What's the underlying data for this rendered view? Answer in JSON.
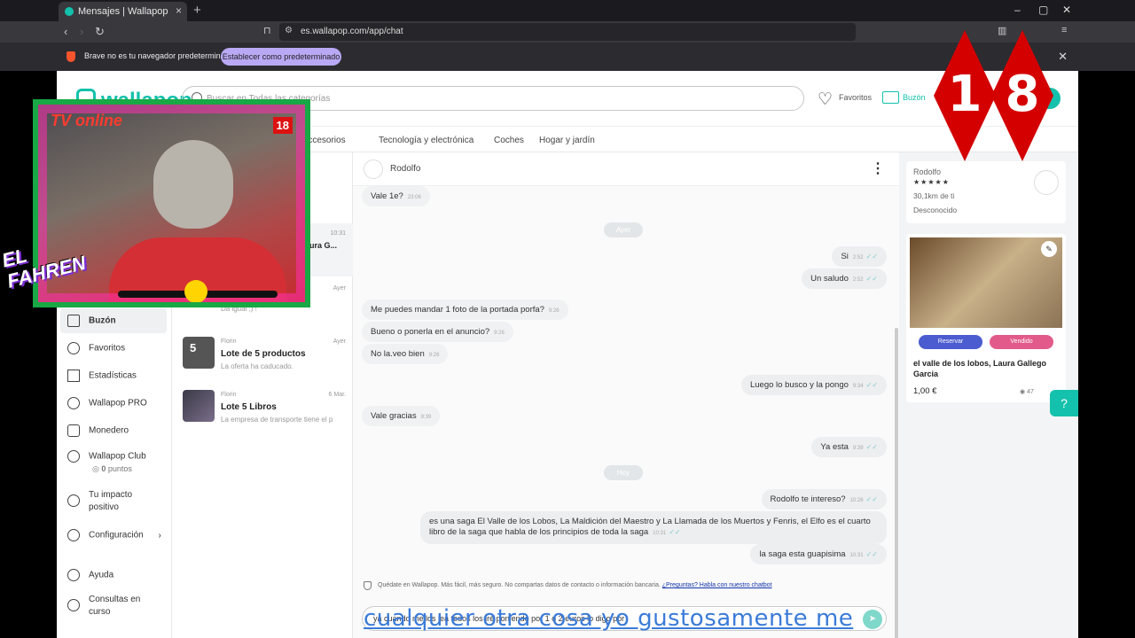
{
  "browser": {
    "tab_title": "Mensajes | Wallapop",
    "url": "es.wallapop.com/app/chat",
    "infobar_message": "Brave no es tu navegador predeterminado",
    "infobar_button": "Establecer como predeterminado"
  },
  "header": {
    "logo": "wallapop",
    "search_placeholder": "Buscar en Todas las categorías",
    "favorites_label": "Favoritos",
    "inbox_label": "Buzón"
  },
  "categories": [
    "y accesorios",
    "Tecnología y electrónica",
    "Coches",
    "Hogar y jardín"
  ],
  "sidebar": {
    "items": [
      {
        "label": "Buzón",
        "icon": "mail-icon"
      },
      {
        "label": "Favoritos",
        "icon": "heart-icon"
      },
      {
        "label": "Estadísticas",
        "icon": "chart-icon"
      },
      {
        "label": "Wallapop PRO",
        "icon": "badge-icon"
      },
      {
        "label": "Monedero",
        "icon": "wallet-icon"
      },
      {
        "label": "Wallapop Club",
        "icon": "globe-icon"
      },
      {
        "label": "Tu impacto positivo",
        "icon": "leaf-icon"
      },
      {
        "label": "Configuración",
        "icon": "gear-icon"
      },
      {
        "label": "Ayuda",
        "icon": "help-icon"
      },
      {
        "label": "Consultas en curso",
        "icon": "history-icon"
      }
    ],
    "club_points": "0",
    "club_points_unit": "puntos"
  },
  "conversations": [
    {
      "who": "",
      "date": "10:31",
      "title": "aura G...",
      "preview": ""
    },
    {
      "who": "",
      "date": "Ayer",
      "title": "",
      "preview": "Da igual ;) !"
    },
    {
      "who": "Florin",
      "date": "Ayer",
      "title": "Lote de 5 productos",
      "preview": "La oferta ha caducado.",
      "thumb": "5"
    },
    {
      "who": "Florin",
      "date": "6 Mar.",
      "title": "Lote 5 Libros",
      "preview": "La empresa de transporte tiene el p"
    }
  ],
  "chat": {
    "contact": "Rodolfo",
    "day_yesterday": "Ayer",
    "day_today": "Hoy",
    "messages": [
      {
        "text": "Vale 1e?",
        "time": "23:06"
      },
      {
        "text": "Si",
        "time": "2:52"
      },
      {
        "text": "Un saludo",
        "time": "2:52"
      },
      {
        "text": "Me puedes mandar 1 foto de la portada porfa?",
        "time": "9:26"
      },
      {
        "text": "Bueno o ponerla en el anuncio?",
        "time": "9:26"
      },
      {
        "text": "No la.veo bien",
        "time": "9:26"
      },
      {
        "text": "Luego lo busco y la pongo",
        "time": "9:34"
      },
      {
        "text": "Vale gracias",
        "time": "9:39"
      },
      {
        "text": "Ya esta",
        "time": "9:39"
      },
      {
        "text": "Rodolfo te intereso?",
        "time": "10:26"
      },
      {
        "text": "es una saga El Valle de los Lobos, La Maldición del Maestro y La Llamada de los Muertos y  Fenris, el Elfo es el cuarto libro de la saga que habla de los principios de toda la saga",
        "time": "10:31"
      },
      {
        "text": "la saga esta guapisima",
        "time": "10:31"
      }
    ],
    "safety_text": "Quédate en Wallapop. Más fácil, más seguro. No compartas datos de contacto o información bancaria.",
    "safety_link": "¿Preguntas? Habla con nuestro chatbot",
    "composer_text": "ya cuando me los lea todos los iré poniendo por 1 o 2 euros lo digo por"
  },
  "subtitle": "cualquier otra cosa yo gustosamente me",
  "seller": {
    "name": "Rodolfo",
    "stars": "★★★★★",
    "distance": "30,1km de ti",
    "location": "Desconocido"
  },
  "product": {
    "title": "el valle de los lobos, Laura Gallego Garcia",
    "price": "1,00 €",
    "views": "47",
    "reserve_label": "Reservar",
    "sold_label": "Vendido"
  },
  "overlay": {
    "tv_text": "TV online",
    "mini_badge": "18",
    "fahren": "EL FAHREN",
    "badge_digits": [
      "1",
      "8"
    ]
  }
}
